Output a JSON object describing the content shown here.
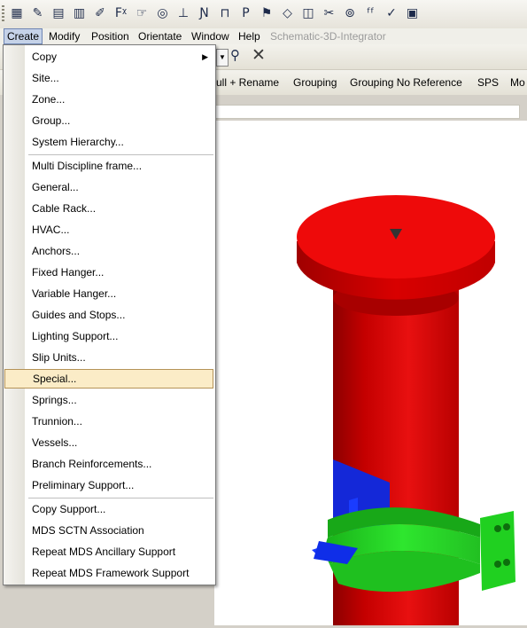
{
  "menubar": {
    "items": [
      {
        "label": "Create",
        "active": true
      },
      {
        "label": "Modify"
      },
      {
        "label": "Position"
      },
      {
        "label": "Orientate"
      },
      {
        "label": "Window"
      },
      {
        "label": "Help"
      },
      {
        "label": "Schematic-3D-Integrator",
        "disabled": true
      }
    ]
  },
  "toolbar_row": {
    "labels": [
      "ull + Rename",
      "Grouping",
      "Grouping No Reference",
      "SPS",
      "Mo"
    ]
  },
  "create_menu": {
    "items": [
      {
        "label": "Copy",
        "submenu": true
      },
      {
        "label": "Site..."
      },
      {
        "label": "Zone..."
      },
      {
        "label": "Group..."
      },
      {
        "label": "System Hierarchy..."
      },
      {
        "label": "Multi Discipline frame..."
      },
      {
        "label": "General..."
      },
      {
        "label": "Cable Rack..."
      },
      {
        "label": "HVAC..."
      },
      {
        "label": "Anchors..."
      },
      {
        "label": "Fixed Hanger..."
      },
      {
        "label": "Variable Hanger..."
      },
      {
        "label": "Guides and Stops..."
      },
      {
        "label": "Lighting Support..."
      },
      {
        "label": "Slip Units..."
      },
      {
        "label": "Special...",
        "highlighted": true
      },
      {
        "label": "Springs..."
      },
      {
        "label": "Trunnion..."
      },
      {
        "label": "Vessels..."
      },
      {
        "label": "Branch Reinforcements..."
      },
      {
        "label": "Preliminary Support..."
      },
      {
        "label": "Copy Support..."
      },
      {
        "label": "MDS SCTN Association"
      },
      {
        "label": "Repeat MDS Ancillary Support"
      },
      {
        "label": "Repeat MDS Framework Support"
      }
    ],
    "submenu_arrow": "▶"
  },
  "icons": {
    "toolbar": [
      "chart-icon",
      "pencil-icon",
      "table-icon",
      "bars-icon",
      "brush-icon",
      "fit-icon",
      "select-icon",
      "lasso-icon",
      "pipe-icon",
      "clamp-icon",
      "elbow-icon",
      "tee-icon",
      "flag-icon",
      "diamond-icon",
      "shape-icon",
      "cut-icon",
      "bulb-icon",
      "fx-icon",
      "wand-icon",
      "list-icon"
    ],
    "find": "binoculars-icon",
    "close": "close-icon"
  },
  "colors": {
    "pipe": "#e01010",
    "clamp": "#22dd22",
    "plate": "#1030e0",
    "highlight": "#fbecc7"
  }
}
